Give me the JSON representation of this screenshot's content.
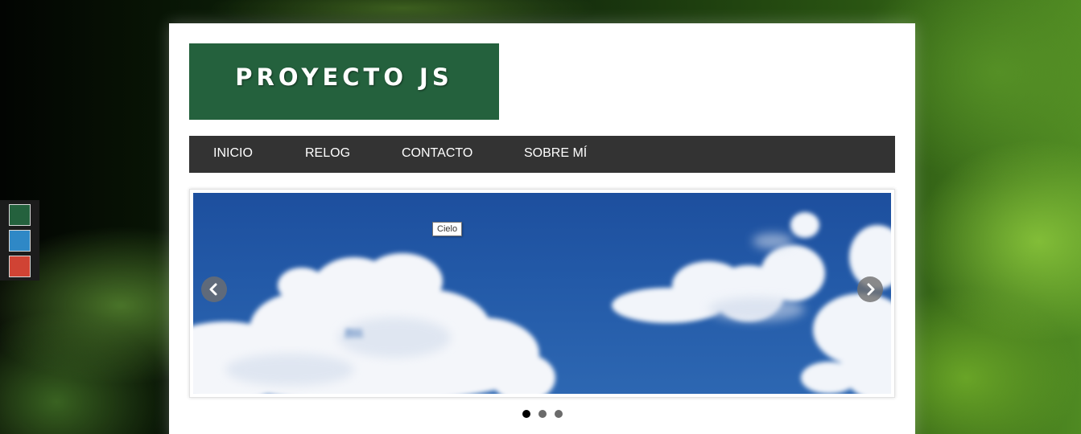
{
  "theme_switcher": {
    "swatches": [
      {
        "name": "green",
        "color": "#24613d"
      },
      {
        "name": "blue",
        "color": "#2f88c6"
      },
      {
        "name": "red",
        "color": "#d04334"
      }
    ]
  },
  "header": {
    "logo_text": "PROYECTO JS",
    "logo_color": "#24613d"
  },
  "nav": {
    "items": [
      {
        "label": "INICIO"
      },
      {
        "label": "RELOG"
      },
      {
        "label": "CONTACTO"
      },
      {
        "label": "SOBRE MÍ"
      }
    ]
  },
  "slider": {
    "current_slide_tooltip": "Cielo",
    "prev_icon": "chevron-left-icon",
    "next_icon": "chevron-right-icon",
    "slide_count": 3,
    "active_index": 0
  }
}
